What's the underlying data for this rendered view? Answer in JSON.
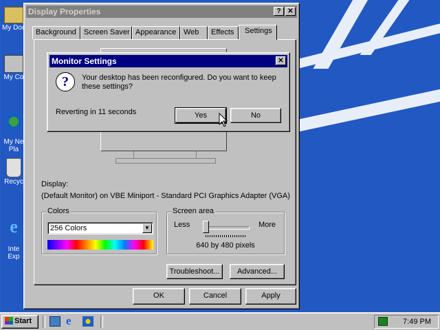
{
  "desktop": {
    "icons": [
      {
        "label": "My Doc",
        "icon": "my-documents-icon"
      },
      {
        "label": "My Co",
        "icon": "my-computer-icon"
      },
      {
        "label": "My Ne\nPla",
        "icon": "network-neighborhood-icon"
      },
      {
        "label": "Recyc",
        "icon": "recycle-bin-icon"
      },
      {
        "label": "Inte\nExp",
        "icon": "internet-explorer-icon"
      }
    ]
  },
  "display_properties": {
    "title": "Display Properties",
    "help_btn": "?",
    "close_btn": "✕",
    "tabs": [
      "Background",
      "Screen Saver",
      "Appearance",
      "Web",
      "Effects",
      "Settings"
    ],
    "active_tab": "Settings",
    "display_label": "Display:",
    "display_value": "(Default Monitor) on VBE Miniport - Standard PCI Graphics Adapter (VGA)",
    "colors": {
      "legend": "Colors",
      "selected": "256 Colors"
    },
    "screen_area": {
      "legend": "Screen area",
      "less": "Less",
      "more": "More",
      "value": "640 by 480 pixels",
      "slider_level": 0.0
    },
    "buttons": {
      "troubleshoot": "Troubleshoot...",
      "advanced": "Advanced...",
      "ok": "OK",
      "cancel": "Cancel",
      "apply": "Apply"
    }
  },
  "monitor_settings": {
    "title": "Monitor Settings",
    "close_btn": "✕",
    "message": "Your desktop has been reconfigured.  Do you want to keep these settings?",
    "countdown": "Reverting in 11 seconds",
    "yes": "Yes",
    "no": "No",
    "icon": "question-icon"
  },
  "taskbar": {
    "start_label": "Start",
    "clock": "7:49 PM",
    "quick_launch": [
      "show-desktop-icon",
      "internet-explorer-icon",
      "channels-icon"
    ]
  },
  "colors": {
    "title_active": "#000080",
    "title_inactive": "#808080",
    "face": "#c0c0c0",
    "desktop": "#2258c2"
  }
}
